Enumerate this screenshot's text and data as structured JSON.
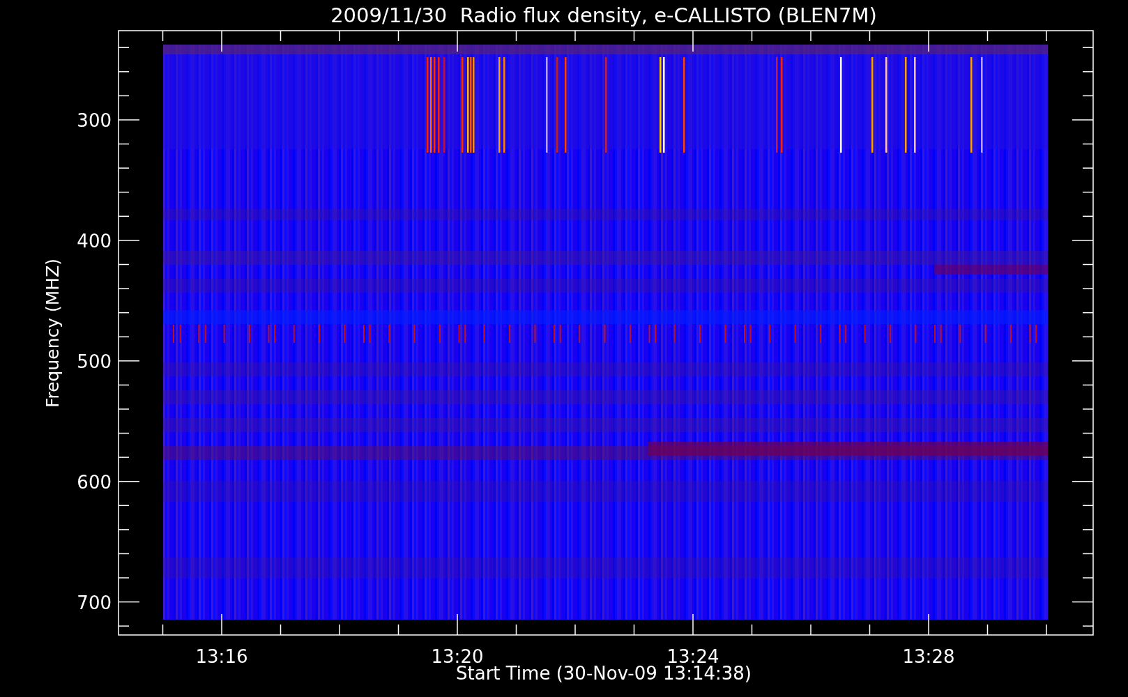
{
  "title": "2009/11/30  Radio flux density, e-CALLISTO (BLEN7M)",
  "y_axis": {
    "label": "Frequency (MHZ)",
    "ticks": [
      "300",
      "400",
      "500",
      "600",
      "700"
    ]
  },
  "x_axis": {
    "label": "Start Time (30-Nov-09 13:14:38)",
    "ticks": [
      "13:16",
      "13:20",
      "13:24",
      "13:28"
    ]
  }
}
